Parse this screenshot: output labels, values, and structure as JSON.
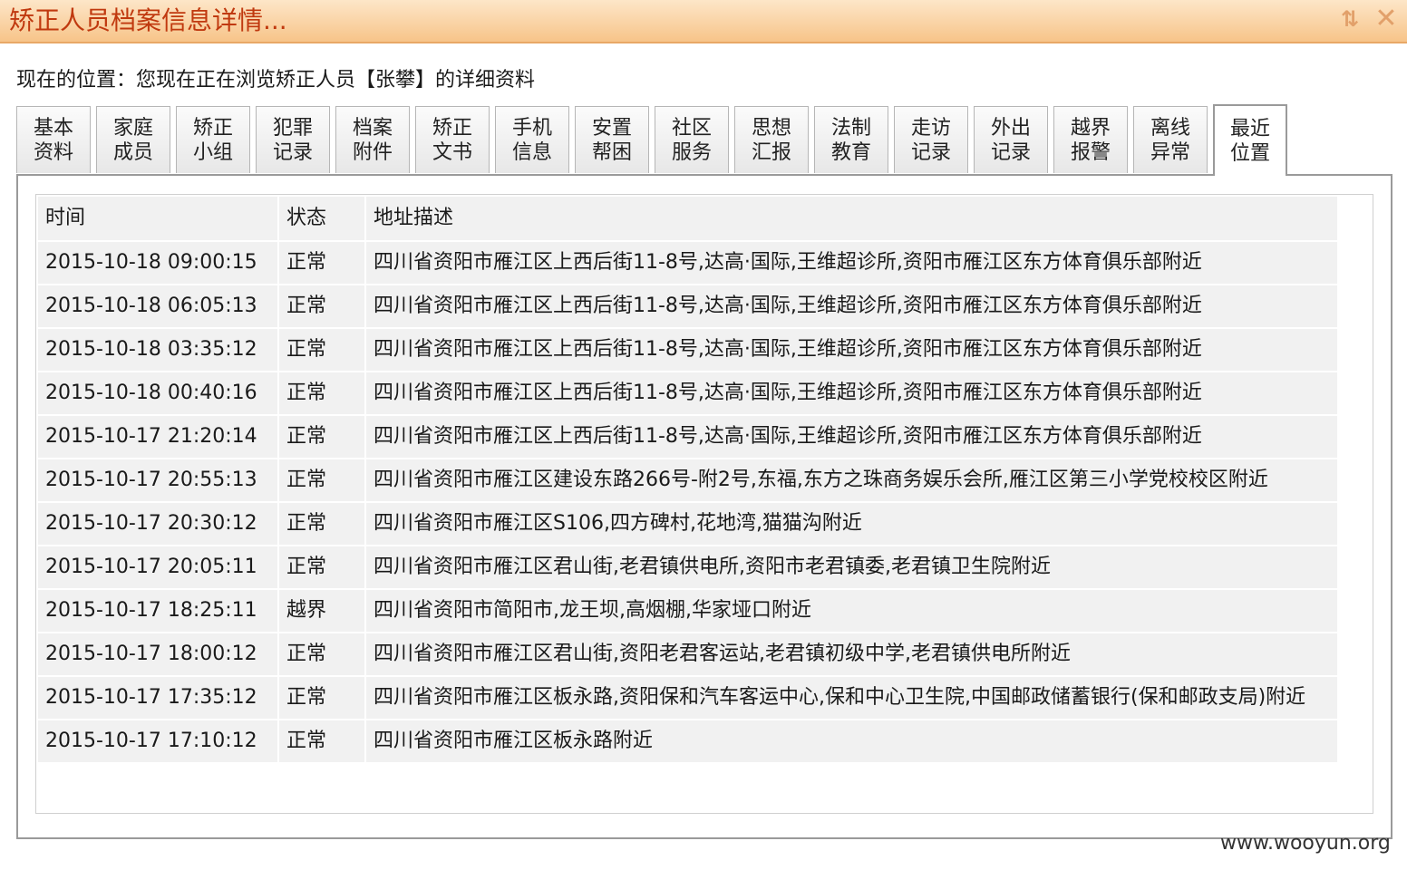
{
  "window": {
    "title": "矫正人员档案信息详情...",
    "move_icon_glyph": "⇅",
    "close_icon_glyph": "✕"
  },
  "location_text": "现在的位置：您现在正在浏览矫正人员【张攀】的详细资料",
  "tabs": [
    {
      "line1": "基本",
      "line2": "资料"
    },
    {
      "line1": "家庭",
      "line2": "成员"
    },
    {
      "line1": "矫正",
      "line2": "小组"
    },
    {
      "line1": "犯罪",
      "line2": "记录"
    },
    {
      "line1": "档案",
      "line2": "附件"
    },
    {
      "line1": "矫正",
      "line2": "文书"
    },
    {
      "line1": "手机",
      "line2": "信息"
    },
    {
      "line1": "安置",
      "line2": "帮困"
    },
    {
      "line1": "社区",
      "line2": "服务"
    },
    {
      "line1": "思想",
      "line2": "汇报"
    },
    {
      "line1": "法制",
      "line2": "教育"
    },
    {
      "line1": "走访",
      "line2": "记录"
    },
    {
      "line1": "外出",
      "line2": "记录"
    },
    {
      "line1": "越界",
      "line2": "报警"
    },
    {
      "line1": "离线",
      "line2": "异常"
    },
    {
      "line1": "最近",
      "line2": "位置"
    }
  ],
  "active_tab_index": 15,
  "table": {
    "headers": [
      "时间",
      "状态",
      "地址描述"
    ],
    "rows": [
      [
        "2015-10-18 09:00:15",
        "正常",
        "四川省资阳市雁江区上西后街11-8号,达高·国际,王维超诊所,资阳市雁江区东方体育俱乐部附近"
      ],
      [
        "2015-10-18 06:05:13",
        "正常",
        "四川省资阳市雁江区上西后街11-8号,达高·国际,王维超诊所,资阳市雁江区东方体育俱乐部附近"
      ],
      [
        "2015-10-18 03:35:12",
        "正常",
        "四川省资阳市雁江区上西后街11-8号,达高·国际,王维超诊所,资阳市雁江区东方体育俱乐部附近"
      ],
      [
        "2015-10-18 00:40:16",
        "正常",
        "四川省资阳市雁江区上西后街11-8号,达高·国际,王维超诊所,资阳市雁江区东方体育俱乐部附近"
      ],
      [
        "2015-10-17 21:20:14",
        "正常",
        "四川省资阳市雁江区上西后街11-8号,达高·国际,王维超诊所,资阳市雁江区东方体育俱乐部附近"
      ],
      [
        "2015-10-17 20:55:13",
        "正常",
        "四川省资阳市雁江区建设东路266号-附2号,东福,东方之珠商务娱乐会所,雁江区第三小学党校校区附近"
      ],
      [
        "2015-10-17 20:30:12",
        "正常",
        "四川省资阳市雁江区S106,四方碑村,花地湾,猫猫沟附近"
      ],
      [
        "2015-10-17 20:05:11",
        "正常",
        "四川省资阳市雁江区君山街,老君镇供电所,资阳市老君镇委,老君镇卫生院附近"
      ],
      [
        "2015-10-17 18:25:11",
        "越界",
        "四川省资阳市简阳市,龙王坝,高烟棚,华家垭口附近"
      ],
      [
        "2015-10-17 18:00:12",
        "正常",
        "四川省资阳市雁江区君山街,资阳老君客运站,老君镇初级中学,老君镇供电所附近"
      ],
      [
        "2015-10-17 17:35:12",
        "正常",
        "四川省资阳市雁江区板永路,资阳保和汽车客运中心,保和中心卫生院,中国邮政储蓄银行(保和邮政支局)附近"
      ],
      [
        "2015-10-17 17:10:12",
        "正常",
        "四川省资阳市雁江区板永路附近"
      ]
    ]
  },
  "scrollbar": {
    "up_glyph": "▲",
    "down_glyph": "▼",
    "grip_glyph": "≡",
    "position_fraction": 0.0
  },
  "watermark": "www.wooyun.org"
}
